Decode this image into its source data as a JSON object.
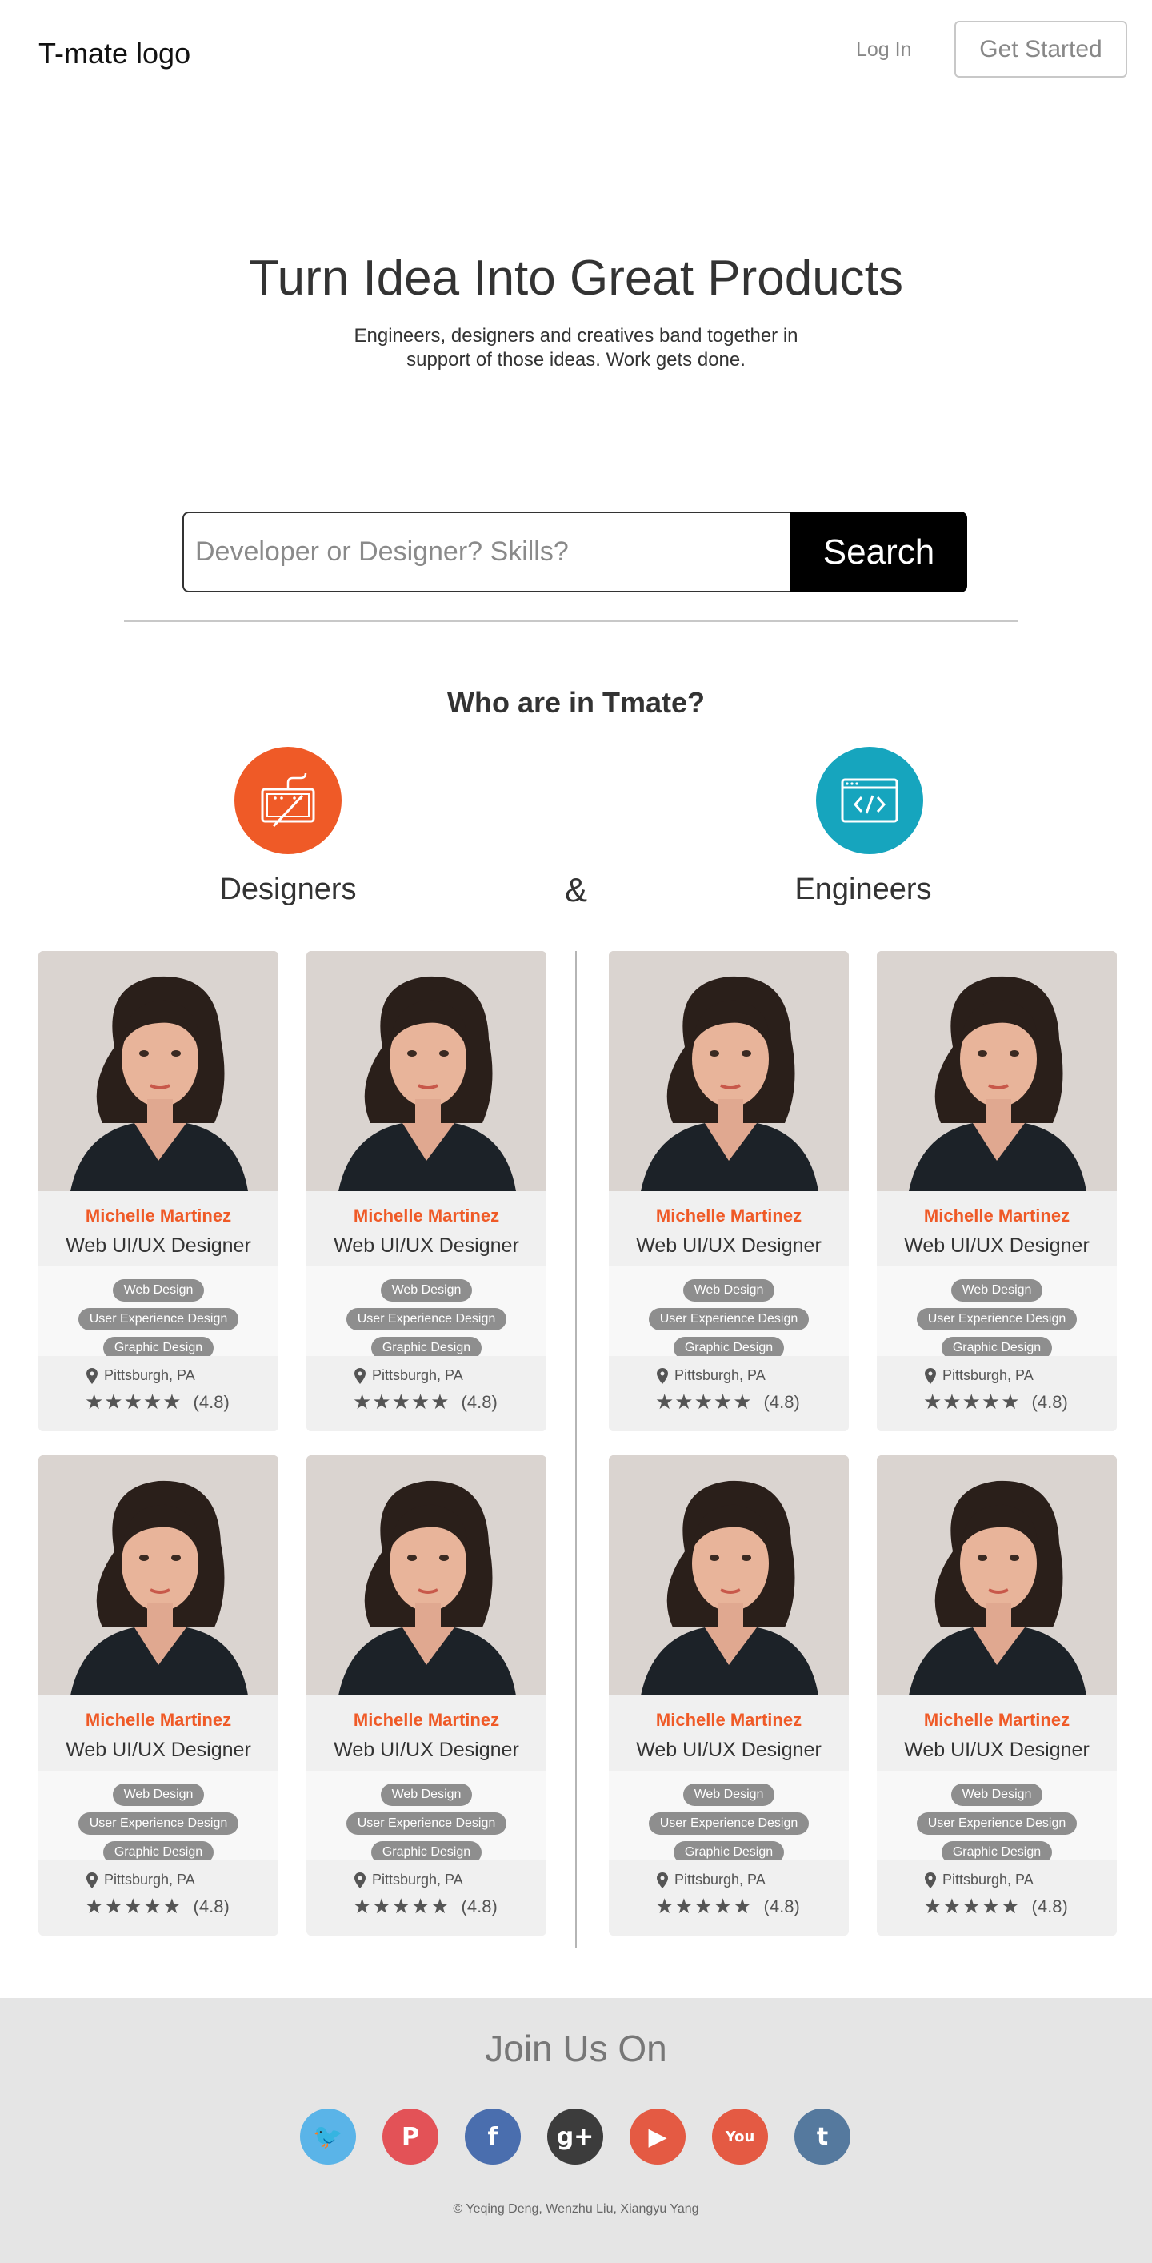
{
  "header": {
    "logo_text": "T-mate logo",
    "login_label": "Log In",
    "get_started_label": "Get Started"
  },
  "hero": {
    "title": "Turn Idea Into Great Products",
    "subtitle": "Engineers, designers and creatives band together in support of those ideas. Work gets done."
  },
  "search": {
    "placeholder": "Developer or Designer? Skills?",
    "value": "",
    "button_label": "Search"
  },
  "who": {
    "title": "Who are in Tmate?",
    "designers_label": "Designers",
    "engineers_label": "Engineers",
    "ampersand": "&",
    "designers_icon": "design-tablet-icon",
    "engineers_icon": "code-window-icon",
    "designers_color": "#ef5a27",
    "engineers_color": "#16a5be"
  },
  "cards": [
    {
      "name": "Michelle Martinez",
      "role": "Web UI/UX Designer",
      "tags": [
        "Web Design",
        "User Experience Design",
        "Graphic Design"
      ],
      "location": "Pittsburgh, PA",
      "stars": "★★★★★",
      "rating": "(4.8)"
    },
    {
      "name": "Michelle Martinez",
      "role": "Web UI/UX Designer",
      "tags": [
        "Web Design",
        "User Experience Design",
        "Graphic Design"
      ],
      "location": "Pittsburgh, PA",
      "stars": "★★★★★",
      "rating": "(4.8)"
    },
    {
      "name": "Michelle Martinez",
      "role": "Web UI/UX Designer",
      "tags": [
        "Web Design",
        "User Experience Design",
        "Graphic Design"
      ],
      "location": "Pittsburgh, PA",
      "stars": "★★★★★",
      "rating": "(4.8)"
    },
    {
      "name": "Michelle Martinez",
      "role": "Web UI/UX Designer",
      "tags": [
        "Web Design",
        "User Experience Design",
        "Graphic Design"
      ],
      "location": "Pittsburgh, PA",
      "stars": "★★★★★",
      "rating": "(4.8)"
    },
    {
      "name": "Michelle Martinez",
      "role": "Web UI/UX Designer",
      "tags": [
        "Web Design",
        "User Experience Design",
        "Graphic Design"
      ],
      "location": "Pittsburgh, PA",
      "stars": "★★★★★",
      "rating": "(4.8)"
    },
    {
      "name": "Michelle Martinez",
      "role": "Web UI/UX Designer",
      "tags": [
        "Web Design",
        "User Experience Design",
        "Graphic Design"
      ],
      "location": "Pittsburgh, PA",
      "stars": "★★★★★",
      "rating": "(4.8)"
    },
    {
      "name": "Michelle Martinez",
      "role": "Web UI/UX Designer",
      "tags": [
        "Web Design",
        "User Experience Design",
        "Graphic Design"
      ],
      "location": "Pittsburgh, PA",
      "stars": "★★★★★",
      "rating": "(4.8)"
    },
    {
      "name": "Michelle Martinez",
      "role": "Web UI/UX Designer",
      "tags": [
        "Web Design",
        "User Experience Design",
        "Graphic Design"
      ],
      "location": "Pittsburgh, PA",
      "stars": "★★★★★",
      "rating": "(4.8)"
    }
  ],
  "footer": {
    "title": "Join Us On",
    "socials": [
      {
        "name": "twitter-icon",
        "color": "#5ab4e8",
        "glyph": "🐦"
      },
      {
        "name": "pinterest-icon",
        "color": "#e35257",
        "glyph": "P"
      },
      {
        "name": "facebook-icon",
        "color": "#4a6eae",
        "glyph": "f"
      },
      {
        "name": "google-plus-icon",
        "color": "#3c3c3c",
        "glyph": "g+"
      },
      {
        "name": "youtube-play-icon",
        "color": "#e45a43",
        "glyph": "▶"
      },
      {
        "name": "youtube-logo-icon",
        "color": "#e45a43",
        "glyph": "You"
      },
      {
        "name": "tumblr-icon",
        "color": "#55799e",
        "glyph": "t"
      }
    ],
    "copyright": "© Yeqing Deng, Wenzhu Liu, Xiangyu Yang"
  }
}
